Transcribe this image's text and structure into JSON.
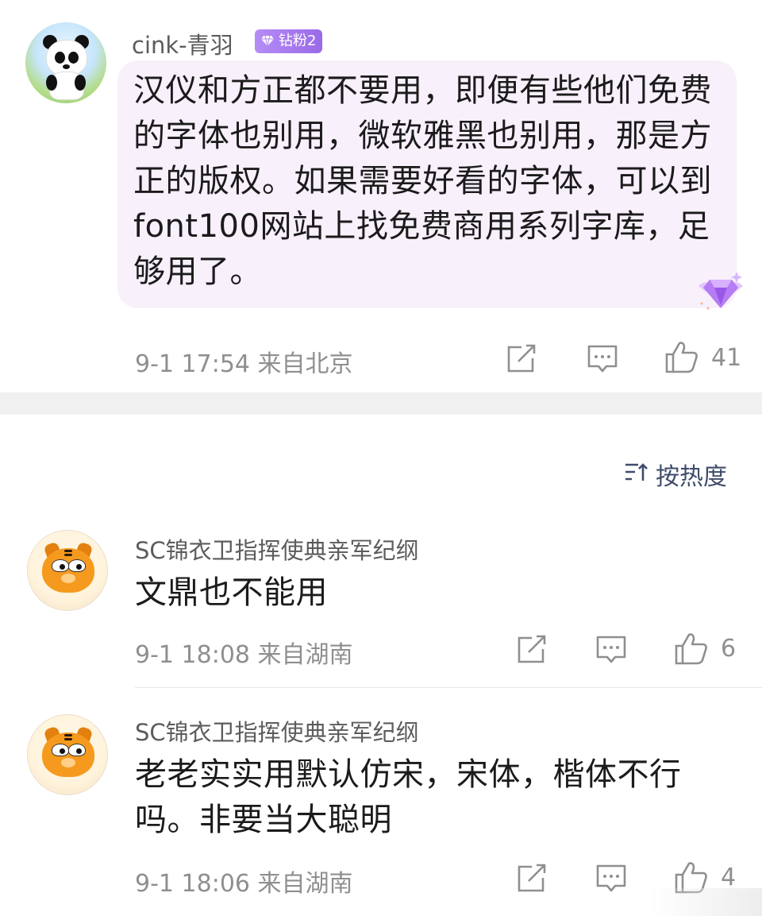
{
  "comment_main": {
    "username": "cink-青羽",
    "badge": "钻粉2",
    "text": "汉仪和方正都不要用，即便有些他们免费的字体也别用，微软雅黑也别用，那是方正的版权。如果需要好看的字体，可以到font100网站上找免费商用系列字库，足够用了。",
    "time_location": "9-1 17:54 来自北京",
    "like_count": "41",
    "avatar_icon": "panda-avatar"
  },
  "sort": {
    "label": "按热度",
    "icon": "sort-icon"
  },
  "replies": [
    {
      "username": "SC锦衣卫指挥使典亲军纪纲",
      "text": "文鼎也不能用",
      "time_location": "9-1 18:08 来自湖南",
      "like_count": "6",
      "avatar_icon": "garfield-avatar"
    },
    {
      "username": "SC锦衣卫指挥使典亲军纪纲",
      "text": "老老实实用默认仿宋，宋体，楷体不行吗。非要当大聪明",
      "time_location": "9-1 18:06 来自湖南",
      "like_count": "4",
      "avatar_icon": "garfield-avatar"
    }
  ],
  "colors": {
    "bubble": "#f8f0fb",
    "badge": "#a97af0",
    "meta_text": "#8f8f8f",
    "sort_text": "#3f4d6b"
  }
}
